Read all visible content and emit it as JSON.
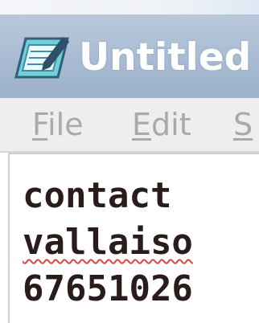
{
  "window": {
    "title": "Untitled -"
  },
  "menu": {
    "items": [
      {
        "label_rest": "ile",
        "mnemonic": "F"
      },
      {
        "label_rest": "dit",
        "mnemonic": "E"
      },
      {
        "label_rest": "",
        "mnemonic": "S"
      }
    ]
  },
  "editor": {
    "lines": [
      "contact",
      "vallaiso",
      "67651026"
    ]
  },
  "colors": {
    "title_bar": "#a8bbd2",
    "menu_text": "#a9a9a9",
    "editor_text": "#2b1c1c",
    "spell_underline": "#e04545"
  },
  "icons": {
    "app": "notepad-icon"
  }
}
